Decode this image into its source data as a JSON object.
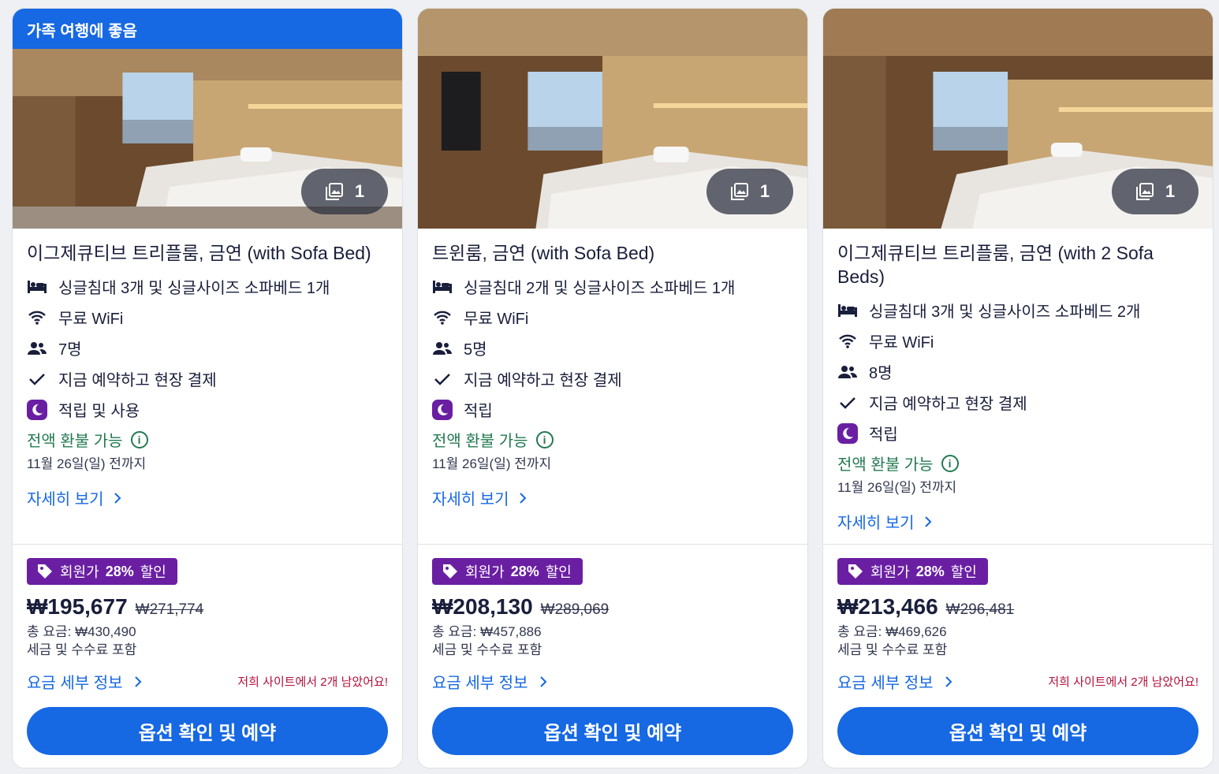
{
  "cards": [
    {
      "badge": "가족 여행에 좋음",
      "photo_count": "1",
      "title": "이그제큐티브 트리플룸, 금연 (with Sofa Bed)",
      "bed": "싱글침대 3개 및 싱글사이즈 소파베드 1개",
      "wifi": "무료 WiFi",
      "guests": "7명",
      "pay": "지금 예약하고 현장 결제",
      "rewards": "적립 및 사용",
      "refund": "전액 환불 가능",
      "refund_until": "11월 26일(일) 전까지",
      "details": "자세히 보기",
      "member_prefix": "회원가",
      "member_pct": "28%",
      "member_suffix": "할인",
      "price": "₩195,677",
      "old_price": "₩271,774",
      "total": "총 요금: ₩430,490",
      "tax_note": "세금 및 수수료 포함",
      "fee_link": "요금 세부 정보",
      "left": "저희 사이트에서 2개 남았어요!",
      "cta": "옵션 확인 및 예약"
    },
    {
      "photo_count": "1",
      "title": "트윈룸, 금연 (with Sofa Bed)",
      "bed": "싱글침대 2개 및 싱글사이즈 소파베드 1개",
      "wifi": "무료 WiFi",
      "guests": "5명",
      "pay": "지금 예약하고 현장 결제",
      "rewards": "적립",
      "refund": "전액 환불 가능",
      "refund_until": "11월 26일(일) 전까지",
      "details": "자세히 보기",
      "member_prefix": "회원가",
      "member_pct": "28%",
      "member_suffix": "할인",
      "price": "₩208,130",
      "old_price": "₩289,069",
      "total": "총 요금: ₩457,886",
      "tax_note": "세금 및 수수료 포함",
      "fee_link": "요금 세부 정보",
      "cta": "옵션 확인 및 예약"
    },
    {
      "photo_count": "1",
      "title": "이그제큐티브 트리플룸, 금연 (with 2 Sofa Beds)",
      "bed": "싱글침대 3개 및 싱글사이즈 소파베드 2개",
      "wifi": "무료 WiFi",
      "guests": "8명",
      "pay": "지금 예약하고 현장 결제",
      "rewards": "적립",
      "refund": "전액 환불 가능",
      "refund_until": "11월 26일(일) 전까지",
      "details": "자세히 보기",
      "member_prefix": "회원가",
      "member_pct": "28%",
      "member_suffix": "할인",
      "price": "₩213,466",
      "old_price": "₩296,481",
      "total": "총 요금: ₩469,626",
      "tax_note": "세금 및 수수료 포함",
      "fee_link": "요금 세부 정보",
      "left": "저희 사이트에서 2개 남았어요!",
      "cta": "옵션 확인 및 예약"
    }
  ],
  "colors": {
    "primary": "#1668e3",
    "member": "#6a1fa3",
    "refund": "#227950",
    "urgent": "#b3103b"
  },
  "icons": {
    "bed": "bed-icon",
    "wifi": "wifi-icon",
    "guests": "people-icon",
    "pay": "check-icon",
    "rewards": "moon-icon",
    "gallery": "gallery-icon",
    "chevron": "chevron-right-icon",
    "tag": "tag-icon",
    "info": "info-icon"
  }
}
